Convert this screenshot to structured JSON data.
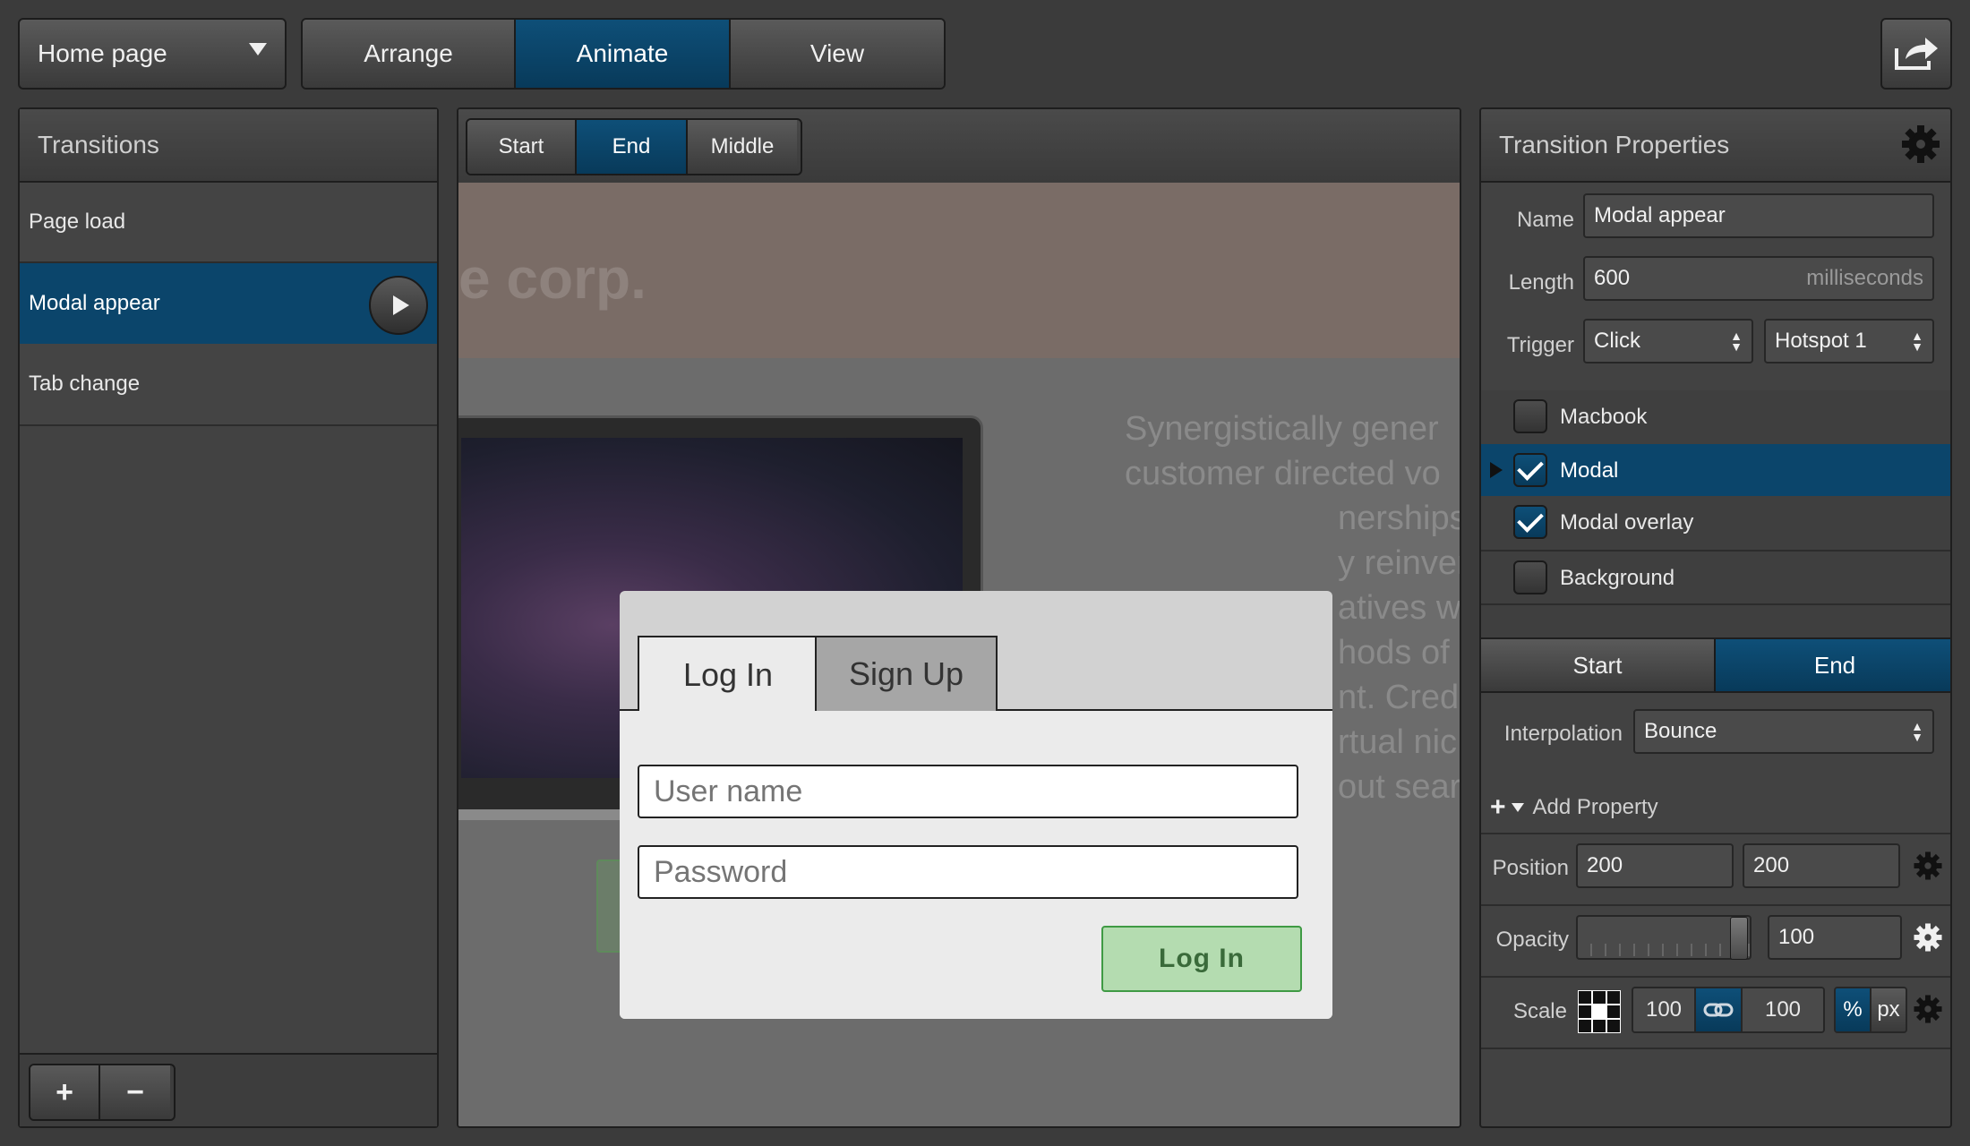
{
  "toolbar": {
    "page_selector": "Home page",
    "modes": [
      "Arrange",
      "Animate",
      "View"
    ],
    "active_mode": "Animate"
  },
  "transitions": {
    "title": "Transitions",
    "items": [
      "Page load",
      "Modal appear",
      "Tab change"
    ],
    "selected": "Modal appear",
    "add_label": "+",
    "remove_label": "−"
  },
  "canvas": {
    "states": [
      "Start",
      "End",
      "Middle"
    ],
    "active_state": "End",
    "brand_fragment": "e corp.",
    "body_lines": [
      "Synergistically gener",
      "customer directed vo",
      "nerships",
      "y reinver",
      "atives wi",
      "hods of",
      "nt. Credi",
      "rtual nic",
      "out sear"
    ],
    "modal": {
      "tabs": [
        "Log In",
        "Sign Up"
      ],
      "active_tab": "Log In",
      "username_placeholder": "User name",
      "password_placeholder": "Password",
      "submit_label": "Log In"
    }
  },
  "properties": {
    "title": "Transition Properties",
    "name_label": "Name",
    "name_value": "Modal appear",
    "length_label": "Length",
    "length_value": "600",
    "length_unit": "milliseconds",
    "trigger_label": "Trigger",
    "trigger_event": "Click",
    "trigger_target": "Hotspot 1",
    "layers": [
      {
        "name": "Macbook",
        "checked": false
      },
      {
        "name": "Modal",
        "checked": true
      },
      {
        "name": "Modal overlay",
        "checked": true
      },
      {
        "name": "Background",
        "checked": false
      }
    ],
    "selected_layer": "Modal",
    "state_tabs": [
      "Start",
      "End"
    ],
    "active_state_tab": "End",
    "interpolation_label": "Interpolation",
    "interpolation_value": "Bounce",
    "add_property_label": "Add Property",
    "position_label": "Position",
    "position_x": "200",
    "position_y": "200",
    "opacity_label": "Opacity",
    "opacity_value": "100",
    "opacity_level": 1.0,
    "scale_label": "Scale",
    "scale_x": "100",
    "scale_y": "100",
    "unit_percent": "%",
    "unit_px": "px",
    "active_unit": "%"
  },
  "colors": {
    "accent": "#0b456b",
    "background": "#3b3b3b",
    "panel": "#424242",
    "login_button": "#b4dcb0"
  }
}
